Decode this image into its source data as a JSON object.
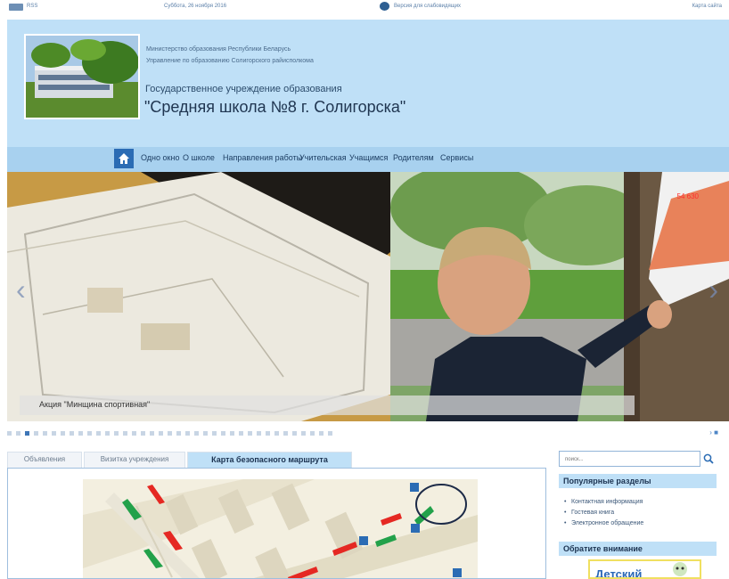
{
  "topbar": {
    "rss_label": "RSS",
    "date": "Суббота, 26 ноября 2016",
    "low_vision_label": "Версия для слабовидящих",
    "sitemap_label": "Карта сайта"
  },
  "header": {
    "ministry": "Министерство образования Республики Беларусь",
    "department": "Управление по образованию Солигорского райисполкома",
    "institution": "Государственное учреждение образования",
    "school_name": "\"Средняя школа №8 г. Солигорска\""
  },
  "nav": {
    "items": [
      "Одно окно",
      "О школе",
      "Направления работы",
      "Учительская",
      "Учащимся",
      "Родителям",
      "Сервисы"
    ]
  },
  "slider": {
    "caption": "Акция \"Минщина спортивная\"",
    "counter": "54 630",
    "prev_icon": "chevron-left-icon",
    "next_icon": "chevron-right-icon",
    "active_index": 2,
    "pager_end": "› ■"
  },
  "tabs": {
    "items": [
      "Объявления",
      "Визитка учреждения",
      "Карта безопасного маршрута"
    ],
    "active": 2
  },
  "sidebar": {
    "search_placeholder": "поиск...",
    "popular_title": "Популярные разделы",
    "popular_links": [
      "Контактная информация",
      "Гостевая книга",
      "Электронное обращение"
    ],
    "attention_title": "Обратите внимание",
    "banner_text": "Детский"
  },
  "colors": {
    "header_bg": "#bfe0f7",
    "nav_bg": "#a8d1ef",
    "accent": "#2b6cb4",
    "route_red": "#e52822",
    "route_green": "#22a14a"
  }
}
